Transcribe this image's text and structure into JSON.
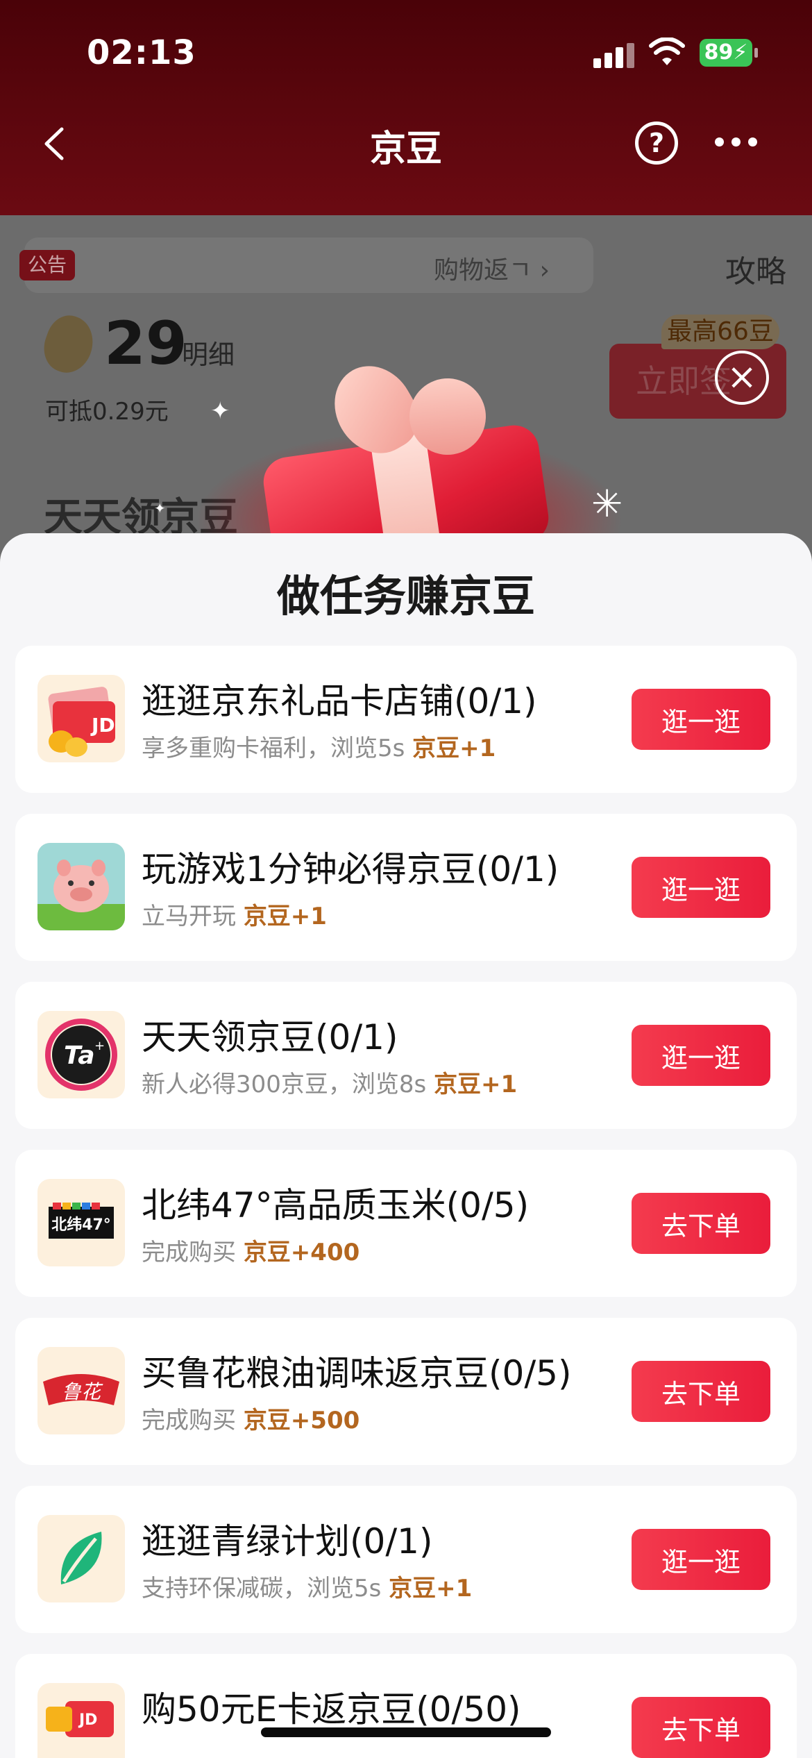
{
  "status_bar": {
    "time": "02:13",
    "battery": "89"
  },
  "nav": {
    "title": "京豆"
  },
  "background_page": {
    "notice_tag": "公告",
    "notice_text": "购物返ㄱ",
    "strategy": "攻略",
    "bean_count": "29",
    "detail_link": "明细",
    "deduct_text": "可抵0.29元",
    "max_tag": "最高66豆",
    "sign_button": "立即签",
    "daily_title": "天天领京豆"
  },
  "sheet": {
    "title": "做任务赚京豆",
    "tasks": [
      {
        "name": "逛逛京东礼品卡店铺(0/1)",
        "desc": "享多重购卡福利，浏览5s",
        "reward": "京豆+1",
        "button": "逛一逛",
        "icon": "jd-gift-card-icon"
      },
      {
        "name": "玩游戏1分钟必得京豆(0/1)",
        "desc": "立马开玩",
        "reward": "京豆+1",
        "button": "逛一逛",
        "icon": "pig-game-icon"
      },
      {
        "name": "天天领京豆(0/1)",
        "desc": "新人必得300京豆，浏览8s",
        "reward": "京豆+1",
        "button": "逛一逛",
        "icon": "ta-app-icon"
      },
      {
        "name": "北纬47°高品质玉米(0/5)",
        "desc": "完成购买",
        "reward": "京豆+400",
        "button": "去下单",
        "icon": "beiwei47-logo",
        "icon_text": "北纬47°"
      },
      {
        "name": "买鲁花粮油调味返京豆(0/5)",
        "desc": "完成购买",
        "reward": "京豆+500",
        "button": "去下单",
        "icon": "luhua-logo",
        "icon_text": "鲁花"
      },
      {
        "name": "逛逛青绿计划(0/1)",
        "desc": "支持环保减碳，浏览5s",
        "reward": "京豆+1",
        "button": "逛一逛",
        "icon": "green-leaf-icon"
      },
      {
        "name": "购50元E卡返京豆(0/50)",
        "desc": "",
        "reward": "",
        "button": "去下单",
        "icon": "jd-ecard-icon"
      }
    ]
  },
  "colors": {
    "accent": "#ea1d3b",
    "reward": "#b3661f",
    "header": "#5a0a10"
  }
}
